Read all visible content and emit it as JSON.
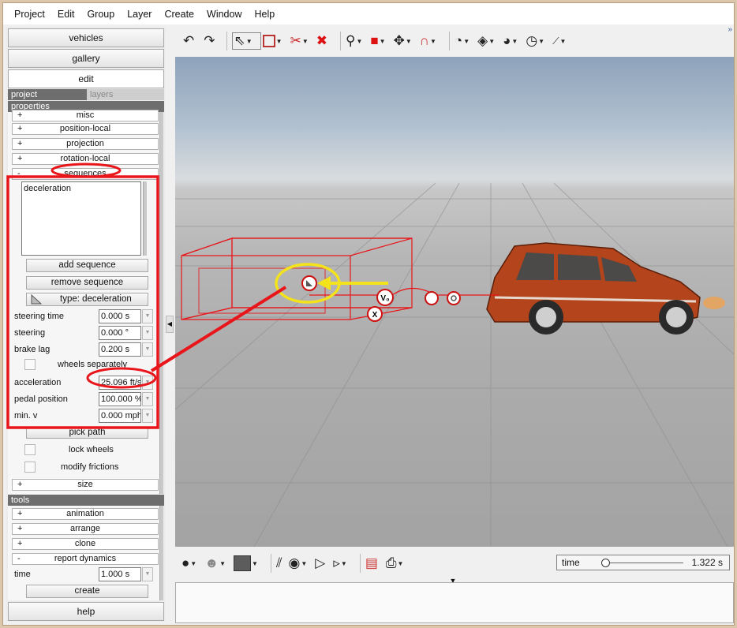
{
  "menu": [
    "Project",
    "Edit",
    "Group",
    "Layer",
    "Create",
    "Window",
    "Help"
  ],
  "nav": {
    "vehicles": "vehicles",
    "gallery": "gallery",
    "edit": "edit"
  },
  "tabs": {
    "project": "project",
    "layers": "layers"
  },
  "sections": {
    "properties": "properties",
    "tools": "tools"
  },
  "properties": {
    "misc": "misc",
    "position_local": "position-local",
    "projection": "projection",
    "rotation_local": "rotation-local",
    "sequences": "sequences",
    "plus": "+",
    "minus": "-",
    "sequence_list": [
      "deceleration"
    ],
    "add_sequence": "add sequence",
    "remove_sequence": "remove sequence",
    "type": "type: deceleration",
    "fields": [
      {
        "label": "steering time",
        "value": "0.000 s"
      },
      {
        "label": "steering",
        "value": "0.000 °"
      },
      {
        "label": "brake lag",
        "value": "0.200 s"
      }
    ],
    "wheels_separately": "wheels separately",
    "fields2": [
      {
        "label": "acceleration",
        "value": "25.096 ft/s"
      },
      {
        "label": "pedal position",
        "value": "100.000 %"
      },
      {
        "label": "min. v",
        "value": "0.000 mph"
      }
    ],
    "pick_path": "pick path",
    "lock_wheels": "lock wheels",
    "modify_frictions": "modify frictions",
    "size": "size"
  },
  "tools": {
    "animation": "animation",
    "arrange": "arrange",
    "clone": "clone",
    "report_dynamics": "report dynamics",
    "time_label": "time",
    "time_value": "1.000 s",
    "create": "create"
  },
  "help": "help",
  "timebar": {
    "label": "time",
    "value": "1.322 s",
    "slider_fraction": 0.05
  },
  "viewport_markers": {
    "v0": "V₀",
    "x": "X"
  },
  "toolbar_icons": [
    "undo-icon",
    "redo-icon",
    "select-icon",
    "box-select-icon",
    "delete-vehicle-icon",
    "delete-icon",
    "zoom-icon",
    "cube-icon",
    "move-icon",
    "magnet-icon",
    "gauge-icon",
    "ruler-icon",
    "measure-icon",
    "dial-icon",
    "scale-icon"
  ],
  "colors": {
    "annotation_red": "#e8161b",
    "annotation_yellow": "#f4e21b",
    "section_gray": "#6e6e6e"
  }
}
